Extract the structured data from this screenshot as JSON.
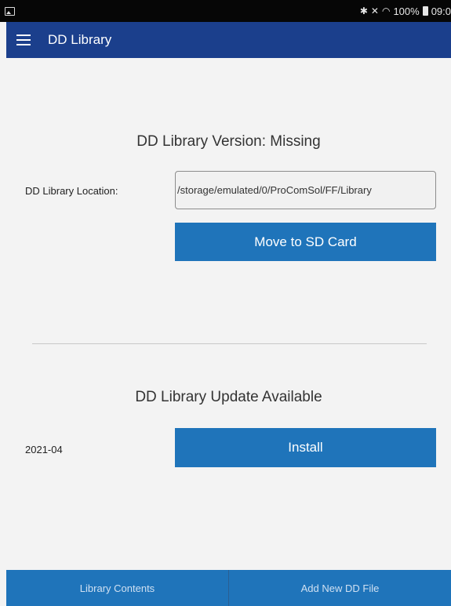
{
  "status_bar": {
    "icons": [
      "image-icon",
      "bluetooth-icon",
      "mute-icon",
      "wifi-icon",
      "battery-icon"
    ],
    "battery": "100%",
    "time": "09:0"
  },
  "app_bar": {
    "title": "DD Library",
    "menu_icon": "hamburger-menu-icon",
    "background": "#1b3f8c"
  },
  "library_status": {
    "heading": "DD Library Version: Missing",
    "location_label": "DD Library Location:",
    "location_value": "/storage/emulated/0/ProComSol/FF/Library",
    "move_button": "Move to SD Card"
  },
  "update": {
    "heading": "DD Library Update Available",
    "version": "2021-04",
    "install_button": "Install"
  },
  "bottom_tabs": [
    "Library Contents",
    "Add New DD File"
  ],
  "colors": {
    "accent": "#1f74ba",
    "header": "#1b3f8c",
    "background": "#f3f3f3"
  }
}
